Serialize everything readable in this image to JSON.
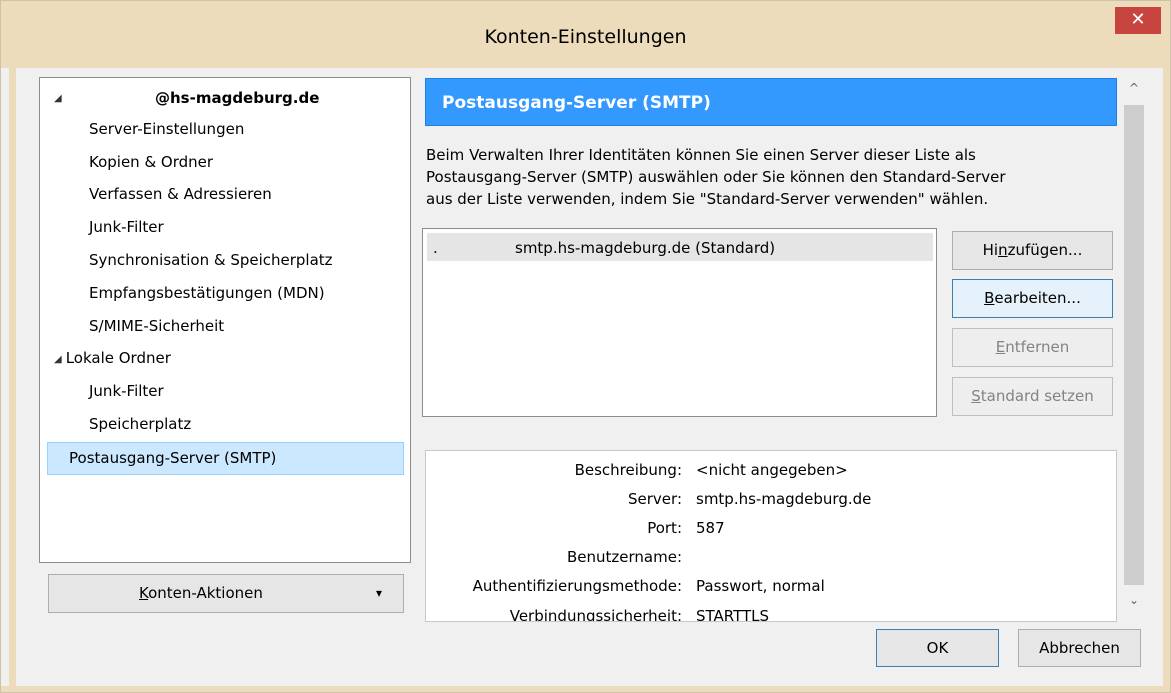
{
  "window": {
    "title": "Konten-Einstellungen",
    "close_glyph": "✕"
  },
  "tree": {
    "items": [
      {
        "label": "@hs-magdeburg.de",
        "bold": true,
        "arrow": "◢"
      },
      {
        "label": "Server-Einstellungen"
      },
      {
        "label": "Kopien & Ordner"
      },
      {
        "label": "Verfassen & Adressieren"
      },
      {
        "label": "Junk-Filter"
      },
      {
        "label": "Synchronisation & Speicherplatz"
      },
      {
        "label": "Empfangsbestätigungen (MDN)"
      },
      {
        "label": "S/MIME-Sicherheit"
      },
      {
        "label": "Lokale Ordner",
        "arrow": "◢"
      },
      {
        "label": "Junk-Filter"
      },
      {
        "label": "Speicherplatz"
      },
      {
        "label": "Postausgang-Server (SMTP)",
        "selected": true
      }
    ]
  },
  "account_actions": {
    "label_underlined": "K",
    "label_rest": "onten-Aktionen",
    "dropdown_glyph": "▾"
  },
  "panel": {
    "header": "Postausgang-Server (SMTP)",
    "description": [
      "Beim Verwalten Ihrer Identitäten können Sie einen Server dieser Liste als",
      "Postausgang-Server (SMTP) auswählen oder Sie können den Standard-Server",
      "aus der Liste verwenden, indem Sie \"Standard-Server verwenden\" wählen."
    ],
    "server_list": [
      {
        "prefix": ".",
        "text": "smtp.hs-magdeburg.de (Standard)"
      }
    ],
    "buttons": {
      "add": {
        "pre": "Hi",
        "u": "n",
        "post": "zufügen..."
      },
      "edit": {
        "pre": "",
        "u": "B",
        "post": "earbeiten..."
      },
      "remove": {
        "pre": "",
        "u": "E",
        "post": "ntfernen"
      },
      "set_default": {
        "pre": "",
        "u": "S",
        "post": "tandard setzen"
      }
    },
    "details": {
      "rows": [
        {
          "label": "Beschreibung:",
          "value": "<nicht angegeben>"
        },
        {
          "label": "Server:",
          "value": "smtp.hs-magdeburg.de"
        },
        {
          "label": "Port:",
          "value": "587"
        },
        {
          "label": "Benutzername:",
          "value": ""
        },
        {
          "label": "Authentifizierungsmethode:",
          "value": "Passwort, normal"
        },
        {
          "label": "Verbindungssicherheit:",
          "value": "STARTTLS"
        }
      ]
    }
  },
  "footer": {
    "ok": "OK",
    "cancel": "Abbrechen"
  },
  "scrollbar": {
    "up": "^",
    "down": "⌄"
  }
}
